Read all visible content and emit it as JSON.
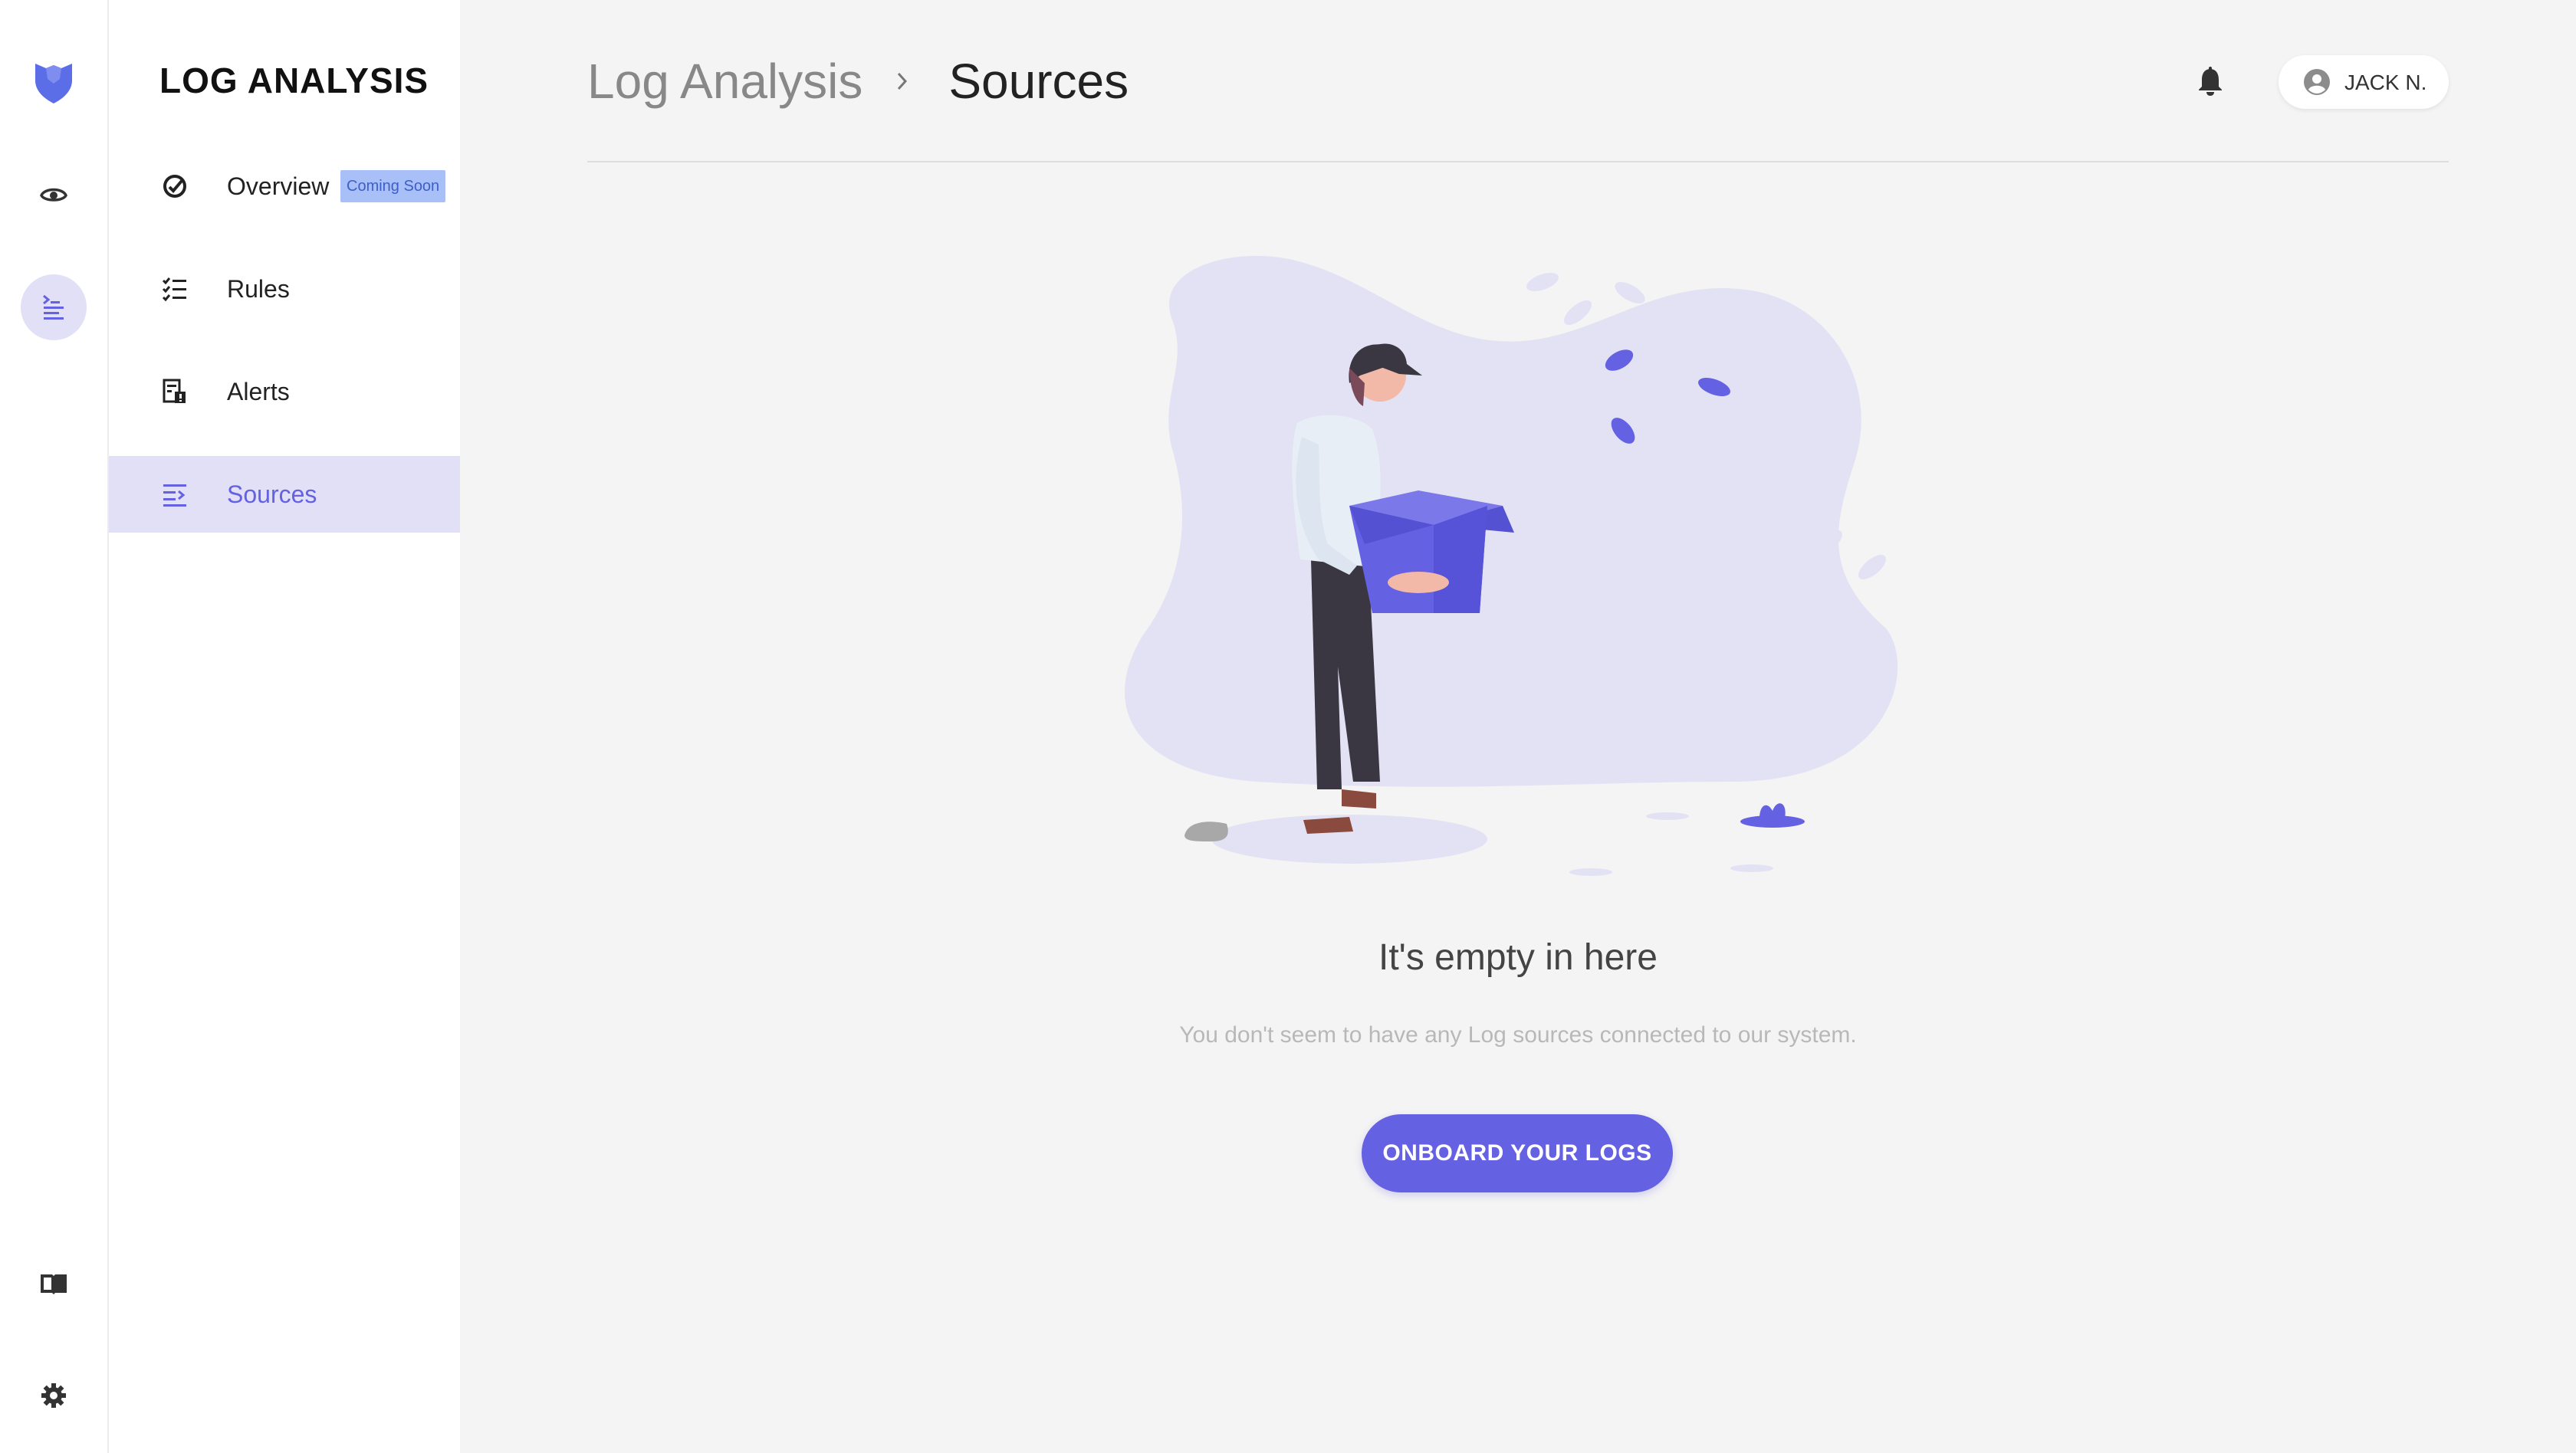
{
  "rail": {
    "items": [
      {
        "icon": "logo-icon"
      },
      {
        "icon": "eye-icon"
      },
      {
        "icon": "log-analysis-icon",
        "active": true
      },
      {
        "icon": "docs-icon"
      },
      {
        "icon": "settings-icon"
      }
    ]
  },
  "nav": {
    "title": "LOG ANALYSIS",
    "items": [
      {
        "label": "Overview",
        "icon": "overview-icon",
        "badge": "Coming Soon"
      },
      {
        "label": "Rules",
        "icon": "rules-icon"
      },
      {
        "label": "Alerts",
        "icon": "alerts-icon"
      },
      {
        "label": "Sources",
        "icon": "sources-icon",
        "active": true
      }
    ]
  },
  "header": {
    "breadcrumb_parent": "Log Analysis",
    "breadcrumb_current": "Sources",
    "user_name": "JACK N."
  },
  "empty_state": {
    "title": "It's empty in here",
    "subtitle": "You don't seem to have any Log sources connected to our system.",
    "cta_label": "ONBOARD YOUR LOGS"
  },
  "colors": {
    "accent": "#6461e3",
    "active_bg": "#e1e0f7",
    "badge_bg": "#a9bff7",
    "badge_text": "#3f5fc6"
  }
}
